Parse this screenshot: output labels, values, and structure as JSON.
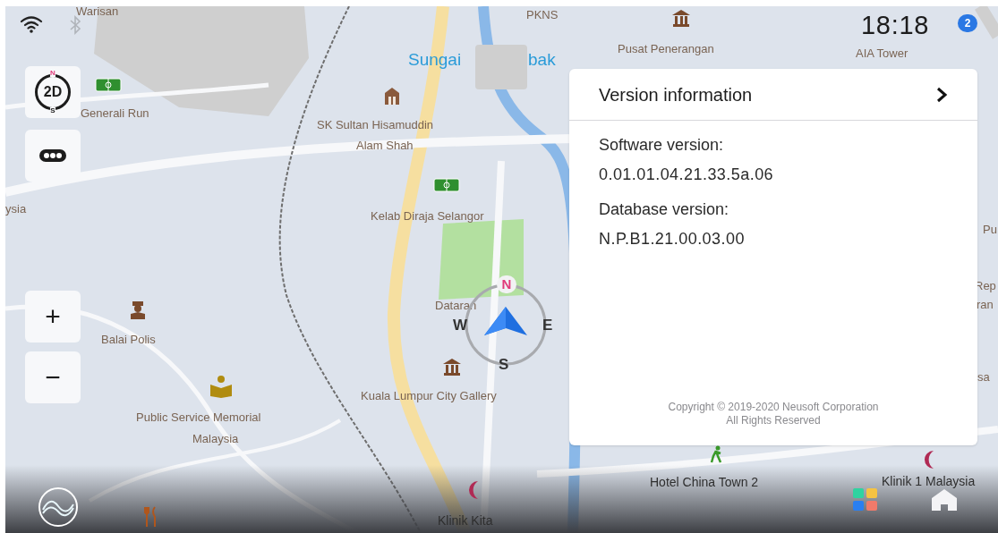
{
  "status_bar": {
    "time": "18:18",
    "notification_count": "2"
  },
  "map_labels": [
    {
      "text": "Warisan",
      "kind": "place"
    },
    {
      "text": "PKNS",
      "kind": "place"
    },
    {
      "text": "Sungai",
      "kind": "water"
    },
    {
      "text": "bak",
      "kind": "water"
    },
    {
      "text": "Pusat Penerangan",
      "kind": "place"
    },
    {
      "text": "AIA Tower",
      "kind": "place"
    },
    {
      "text": "Generali Run",
      "kind": "place"
    },
    {
      "text": "SK Sultan Hisamuddin",
      "kind": "place"
    },
    {
      "text": "Alam Shah",
      "kind": "place"
    },
    {
      "text": "ysia",
      "kind": "place"
    },
    {
      "text": "Kelab Diraja Selangor",
      "kind": "place"
    },
    {
      "text": "Dataran",
      "kind": "place"
    },
    {
      "text": "Balai Polis",
      "kind": "place"
    },
    {
      "text": "Kuala Lumpur City Gallery",
      "kind": "place"
    },
    {
      "text": "Public Service Memorial",
      "kind": "place"
    },
    {
      "text": "Malaysia",
      "kind": "place"
    },
    {
      "text": "Hotel China Town 2",
      "kind": "dark"
    },
    {
      "text": "Klinik 1 Malaysia",
      "kind": "dark"
    },
    {
      "text": "Klinik Kita",
      "kind": "dark"
    },
    {
      "text": "Pu",
      "kind": "place"
    },
    {
      "text": "Rep",
      "kind": "place"
    },
    {
      "text": "ran",
      "kind": "place"
    },
    {
      "text": "sa",
      "kind": "place"
    }
  ],
  "view_button": {
    "label": "2D",
    "north": "N",
    "south": "S"
  },
  "zoom_buttons": [
    "+",
    "−"
  ],
  "compass": {
    "north": "N",
    "west": "W",
    "east": "E",
    "south": "S"
  },
  "panel": {
    "title": "Version information",
    "items": [
      {
        "label": "Software version:",
        "value": "0.01.01.04.21.33.5a.06"
      },
      {
        "label": "Database version:",
        "value": "N.P.B1.21.00.03.00"
      }
    ],
    "copyright": [
      "Copyright © 2019-2020 Neusoft Corporation",
      "All Rights Reserved"
    ]
  }
}
